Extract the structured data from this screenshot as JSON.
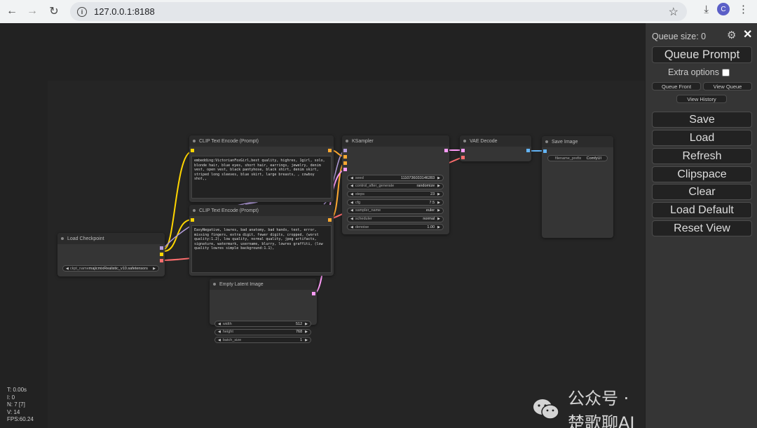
{
  "browser": {
    "url": "127.0.0.1:8188",
    "avatar_letter": "C"
  },
  "nodes": {
    "clip_pos": {
      "title": "CLIP Text Encode (Prompt)",
      "text": "embedding:VictorianFoxGirl,best quality, highres, 1girl, solo, blonde hair, blue eyes, short hair, earrings, jewelry, denim vest, open vest, black pantyhose, black shirt, denim skirt, striped long sleeves, blue skirt, large breasts, , cowboy shot,,"
    },
    "clip_neg": {
      "title": "CLIP Text Encode (Prompt)",
      "text": "EasyNegative, lowres, bad anatomy, bad hands, text, error, missing fingers, extra digit, fewer digits, cropped, (worst quality:1.2), low quality, normal quality, jpeg artifacts, signature, watermark, username, blurry, lowres graffiti, (low quality lowres simple background:1.1),"
    },
    "ksampler": {
      "title": "KSampler",
      "widgets": [
        {
          "label": "seed",
          "value": "1110736033146283"
        },
        {
          "label": "control_after_generate",
          "value": "randomize"
        },
        {
          "label": "steps",
          "value": "23"
        },
        {
          "label": "cfg",
          "value": "7.5"
        },
        {
          "label": "sampler_name",
          "value": "euler"
        },
        {
          "label": "scheduler",
          "value": "normal"
        },
        {
          "label": "denoise",
          "value": "1.00"
        }
      ]
    },
    "vae_decode": {
      "title": "VAE Decode"
    },
    "save_image": {
      "title": "Save Image",
      "filename_label": "filename_prefix",
      "filename_value": "ComfyUI"
    },
    "load_checkpoint": {
      "title": "Load Checkpoint",
      "ckpt_value": "ckpt_name",
      "ckpt_file": "majicmixRealistic_v10.safetensors"
    },
    "empty_latent": {
      "title": "Empty Latent Image",
      "widgets": [
        {
          "label": "width",
          "value": "512"
        },
        {
          "label": "height",
          "value": "768"
        },
        {
          "label": "batch_size",
          "value": "1"
        }
      ]
    }
  },
  "stats": {
    "t": "T: 0.00s",
    "i": "I: 0",
    "n": "N: 7 [7]",
    "v": "V: 14",
    "fps": "FPS:60.24"
  },
  "watermark": "公众号 · 楚歌聊AI",
  "panel": {
    "queue_size": "Queue size: 0",
    "queue_prompt": "Queue Prompt",
    "extra_options": "Extra options",
    "queue_front": "Queue Front",
    "view_queue": "View Queue",
    "view_history": "View History",
    "save": "Save",
    "load": "Load",
    "refresh": "Refresh",
    "clipspace": "Clipspace",
    "clear": "Clear",
    "load_default": "Load Default",
    "reset_view": "Reset View"
  },
  "colors": {
    "clip_slot": "#ffd500",
    "conditioning_slot": "#ffa931",
    "latent_slot": "#ff9cf9",
    "vae_slot": "#ff6e6e",
    "model_slot": "#b39ddb",
    "image_slot": "#64b5f6"
  }
}
